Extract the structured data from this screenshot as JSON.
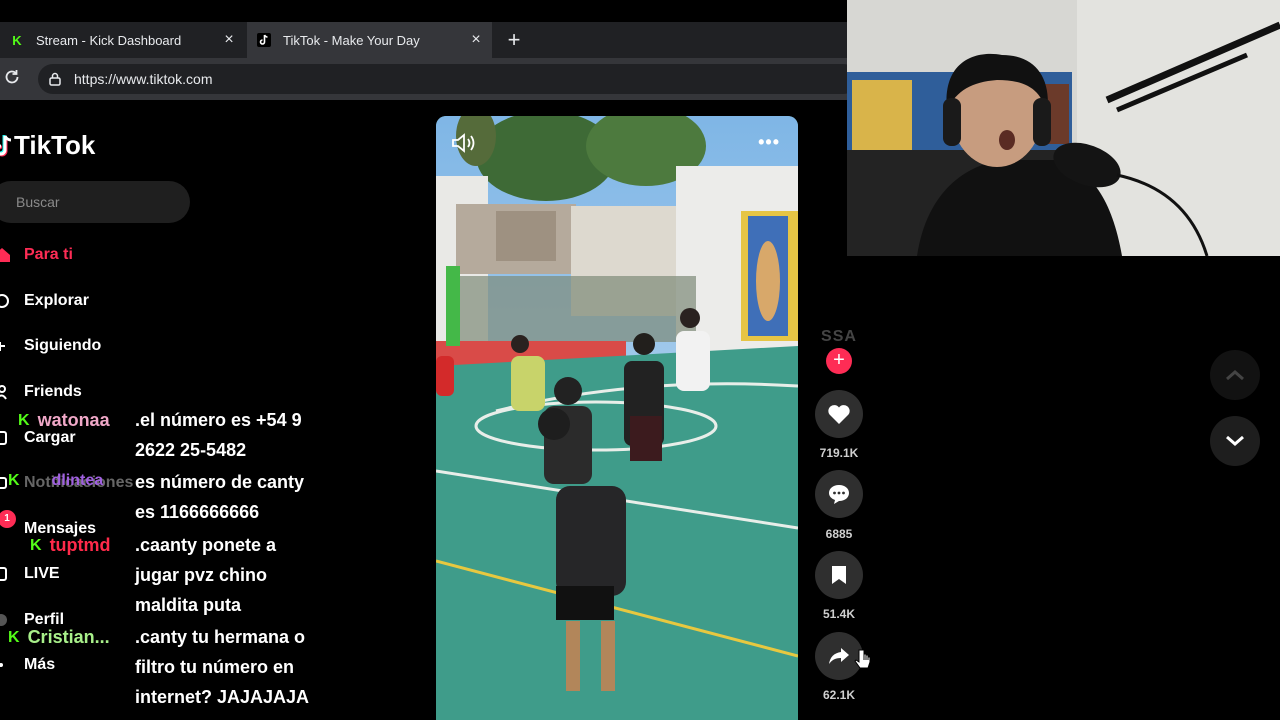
{
  "browser": {
    "tabs": [
      {
        "title": "Stream - Kick Dashboard",
        "favicon": "K",
        "active": false
      },
      {
        "title": "TikTok - Make Your Day",
        "favicon": "tiktok-logo",
        "active": true
      }
    ],
    "new_tab_label": "+",
    "close_label": "×",
    "url": "https://www.tiktok.com"
  },
  "tiktok": {
    "logo_text": "TikTok",
    "search_placeholder": "Buscar",
    "nav": [
      {
        "label": "Para ti",
        "icon": "home-icon",
        "active": true
      },
      {
        "label": "Explorar",
        "icon": "compass-icon"
      },
      {
        "label": "Siguiendo",
        "icon": "following-icon"
      },
      {
        "label": "Friends",
        "icon": "friends-icon"
      },
      {
        "label": "Cargar",
        "icon": "upload-icon"
      },
      {
        "label": "Notificaciones",
        "icon": "inbox-icon"
      },
      {
        "label": "Mensajes",
        "icon": "message-icon",
        "badge": "1"
      },
      {
        "label": "LIVE",
        "icon": "live-icon"
      },
      {
        "label": "Perfil",
        "icon": "avatar-icon"
      },
      {
        "label": "Más",
        "icon": "more-icon"
      }
    ],
    "video": {
      "more_label": "•••",
      "creator_tag": "SSA",
      "follow_label": "+",
      "likes": "719.1K",
      "comments": "6885",
      "saves": "51.4K",
      "shares": "62.1K"
    }
  },
  "chat": {
    "badge_letter": "K",
    "messages": [
      {
        "user": "watonaa",
        "color": "#f0a8c8",
        "lines": [
          ".el número es +54 9",
          "2622 25-5482"
        ]
      },
      {
        "user": "dlintea",
        "color": "#a060e0",
        "lines": [
          "es número de canty",
          "es 1166666666"
        ]
      },
      {
        "user": "tuptmd",
        "color": "#ff2a4a",
        "lines": [
          ".caanty ponete a",
          "jugar pvz chino",
          "maldita puta"
        ]
      },
      {
        "user": "Cristian...",
        "color": "#a8f08a",
        "lines": [
          ".canty tu hermana o",
          "filtro tu número en",
          "internet? JAJAJAJA"
        ]
      }
    ]
  },
  "colors": {
    "tiktok_accent": "#fe2c55",
    "kick_green": "#53fc18",
    "browser_bar": "#35363a",
    "tab_strip": "#202124"
  }
}
